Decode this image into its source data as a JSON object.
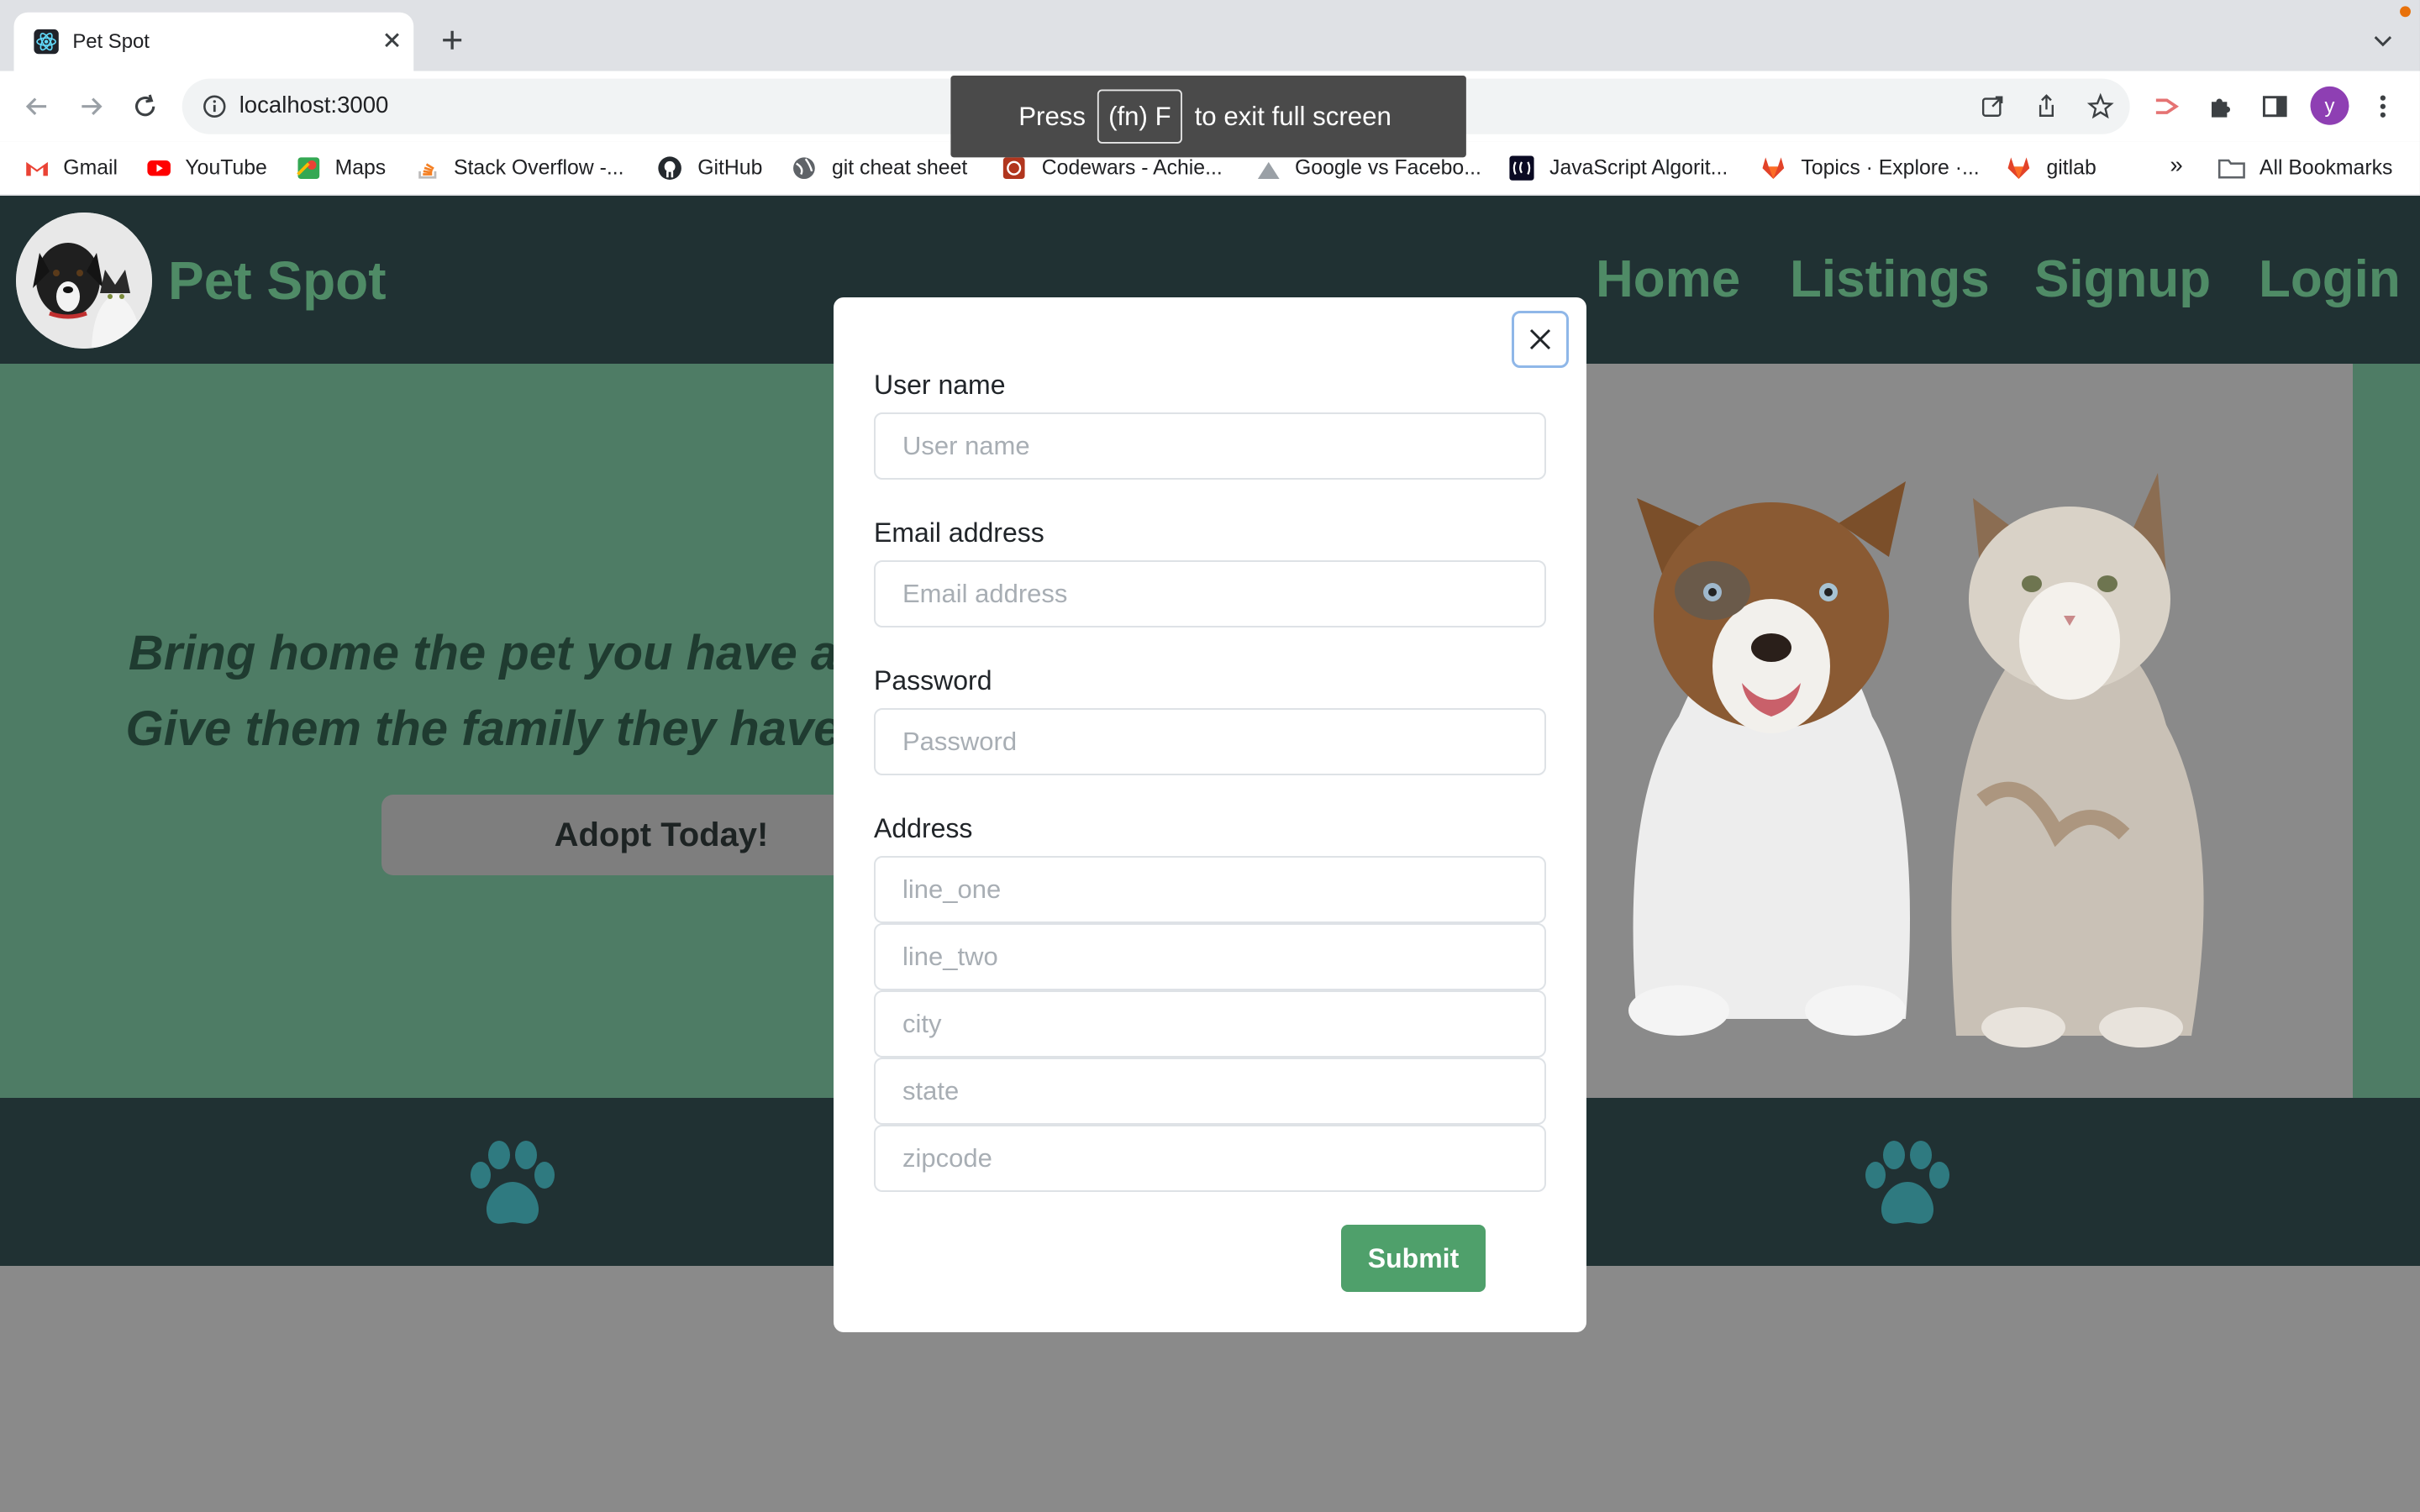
{
  "browser": {
    "tab_title": "Pet Spot",
    "url": "localhost:3000",
    "avatar_letter": "y",
    "fullscreen_notice": {
      "press": "Press",
      "key": "(fn) F",
      "rest": "to exit full screen"
    },
    "bookmarks": [
      {
        "label": "Gmail",
        "icon": "gmail-icon"
      },
      {
        "label": "YouTube",
        "icon": "youtube-icon"
      },
      {
        "label": "Maps",
        "icon": "maps-icon"
      },
      {
        "label": "Stack Overflow -...",
        "icon": "stackoverflow-icon"
      },
      {
        "label": "GitHub",
        "icon": "github-icon"
      },
      {
        "label": "git cheat sheet",
        "icon": "globe-icon"
      },
      {
        "label": "Codewars - Achie...",
        "icon": "codewars-icon"
      },
      {
        "label": "Google vs Facebo...",
        "icon": "chart-icon"
      },
      {
        "label": "JavaScript Algorit...",
        "icon": "freecodecamp-icon"
      },
      {
        "label": "Topics · Explore ·...",
        "icon": "gitlab-icon"
      },
      {
        "label": "gitlab",
        "icon": "gitlab-icon"
      }
    ],
    "more_bookmarks": "»",
    "all_bookmarks": "All Bookmarks"
  },
  "site": {
    "brand": "Pet Spot",
    "nav": [
      "Home",
      "Listings",
      "Signup",
      "Login"
    ],
    "hero": {
      "line1": "Bring home the pet you have a",
      "line2": "Give them the family they have",
      "cta": "Adopt Today!"
    }
  },
  "modal": {
    "username_label": "User name",
    "username_placeholder": "User name",
    "email_label": "Email address",
    "email_placeholder": "Email address",
    "password_label": "Password",
    "password_placeholder": "Password",
    "address_label": "Address",
    "line_one_placeholder": "line_one",
    "line_two_placeholder": "line_two",
    "city_placeholder": "city",
    "state_placeholder": "state",
    "zipcode_placeholder": "zipcode",
    "submit_label": "Submit"
  },
  "colors": {
    "header_bg": "#203133",
    "hero_bg": "#4e7c65",
    "brand_green": "#4f8b66",
    "submit_green": "#4fa06b",
    "paw_teal": "#2f7a80",
    "backdrop": "#8a8a8a"
  }
}
